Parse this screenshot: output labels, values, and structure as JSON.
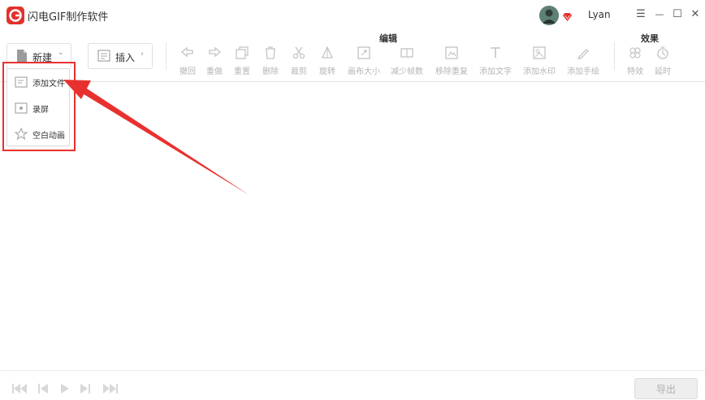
{
  "app": {
    "title": "闪电GIF制作软件"
  },
  "user": {
    "name": "Lyan"
  },
  "window_controls": {
    "menu": "☰",
    "minimize": "—",
    "maximize": "☐",
    "close": "✕"
  },
  "toolbar": {
    "new_label": "新建",
    "insert_label": "插入",
    "group_edit": "编辑",
    "group_effect": "效果",
    "edit_tools": [
      {
        "label": "撤回",
        "icon": "undo-icon"
      },
      {
        "label": "重做",
        "icon": "redo-icon"
      },
      {
        "label": "重置",
        "icon": "reset-icon"
      },
      {
        "label": "删除",
        "icon": "delete-icon"
      },
      {
        "label": "裁剪",
        "icon": "crop-icon"
      },
      {
        "label": "旋转",
        "icon": "rotate-icon"
      },
      {
        "label": "画布大小",
        "icon": "canvas-size-icon"
      },
      {
        "label": "减少帧数",
        "icon": "reduce-frames-icon"
      },
      {
        "label": "移除重复",
        "icon": "remove-duplicates-icon"
      },
      {
        "label": "添加文字",
        "icon": "add-text-icon"
      },
      {
        "label": "添加水印",
        "icon": "add-watermark-icon"
      },
      {
        "label": "添加手绘",
        "icon": "add-drawing-icon"
      }
    ],
    "effect_tools": [
      {
        "label": "特效",
        "icon": "effects-icon"
      },
      {
        "label": "延时",
        "icon": "delay-icon"
      }
    ]
  },
  "new_menu": {
    "items": [
      {
        "label": "添加文件",
        "icon": "add-file-icon"
      },
      {
        "label": "录屏",
        "icon": "screen-record-icon"
      },
      {
        "label": "空白动画",
        "icon": "blank-animation-icon"
      }
    ]
  },
  "bottom": {
    "export_label": "导出"
  },
  "colors": {
    "brand": "#e2312d",
    "annotation": "#e8312f",
    "disabled": "#b5b5b5"
  }
}
